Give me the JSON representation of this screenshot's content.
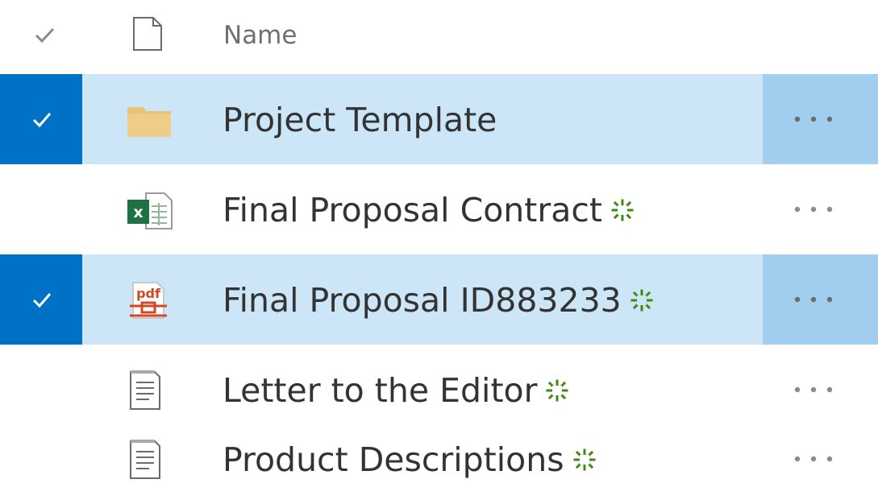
{
  "header": {
    "name_label": "Name",
    "icons": [
      "checkmark-icon",
      "document-icon"
    ]
  },
  "rows": [
    {
      "name": "Project Template",
      "type_icon": "folder-icon",
      "selected": true,
      "is_new": false
    },
    {
      "name": "Final Proposal Contract",
      "type_icon": "excel-icon",
      "selected": false,
      "is_new": true
    },
    {
      "name": "Final Proposal ID883233",
      "type_icon": "pdf-icon",
      "selected": true,
      "is_new": true
    },
    {
      "name": "Letter to the Editor",
      "type_icon": "text-document-icon",
      "selected": false,
      "is_new": true
    },
    {
      "name": "Product Descriptions",
      "type_icon": "text-document-icon",
      "selected": false,
      "is_new": true
    }
  ],
  "colors": {
    "selected_row": "#cde6f7",
    "selected_check": "#0072c6",
    "selected_more": "#a1cdee",
    "new_badge": "#3f8b0f",
    "folder": "#e8c27a",
    "excel": "#1e7145",
    "pdf": "#d24726"
  }
}
